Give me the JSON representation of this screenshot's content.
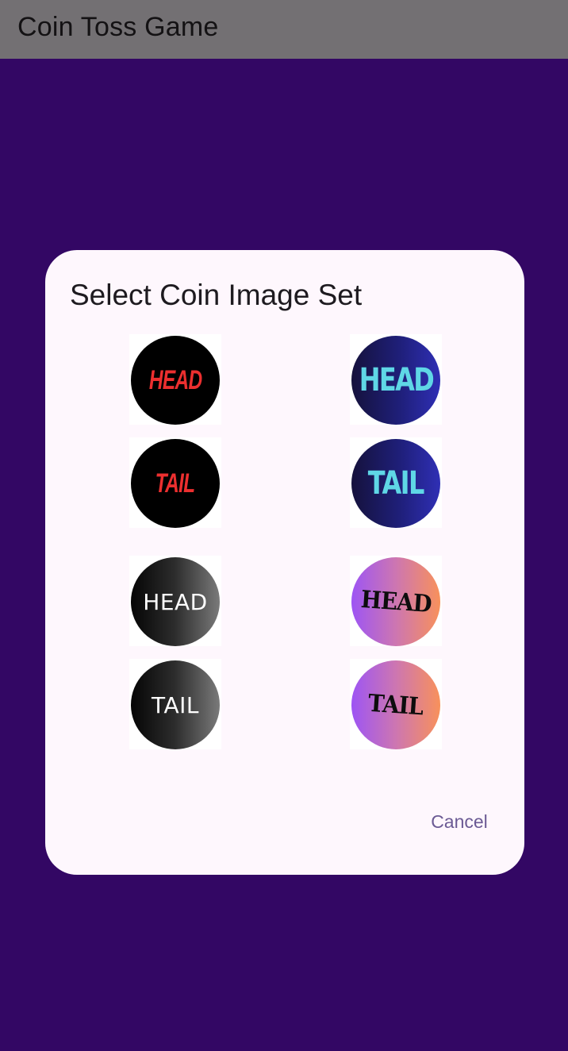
{
  "app_bar": {
    "title": "Coin Toss Game"
  },
  "dialog": {
    "title": "Select Coin Image Set",
    "cancel_label": "Cancel",
    "coin_sets": [
      {
        "head": "HEAD",
        "tail": "TAIL",
        "style": "black coin, red italic text"
      },
      {
        "head": "HEAD",
        "tail": "TAIL",
        "style": "navy gradient coin, cyan bold text"
      },
      {
        "head": "HEAD",
        "tail": "TAIL",
        "style": "black-to-grey gradient coin, white text"
      },
      {
        "head": "HEAD",
        "tail": "TAIL",
        "style": "purple-to-orange gradient coin, black heavy text"
      }
    ]
  },
  "colors": {
    "app_bar": "#737073",
    "background": "#330764",
    "dialog": "#fef7fd",
    "cancel_text": "#6b5a94"
  }
}
